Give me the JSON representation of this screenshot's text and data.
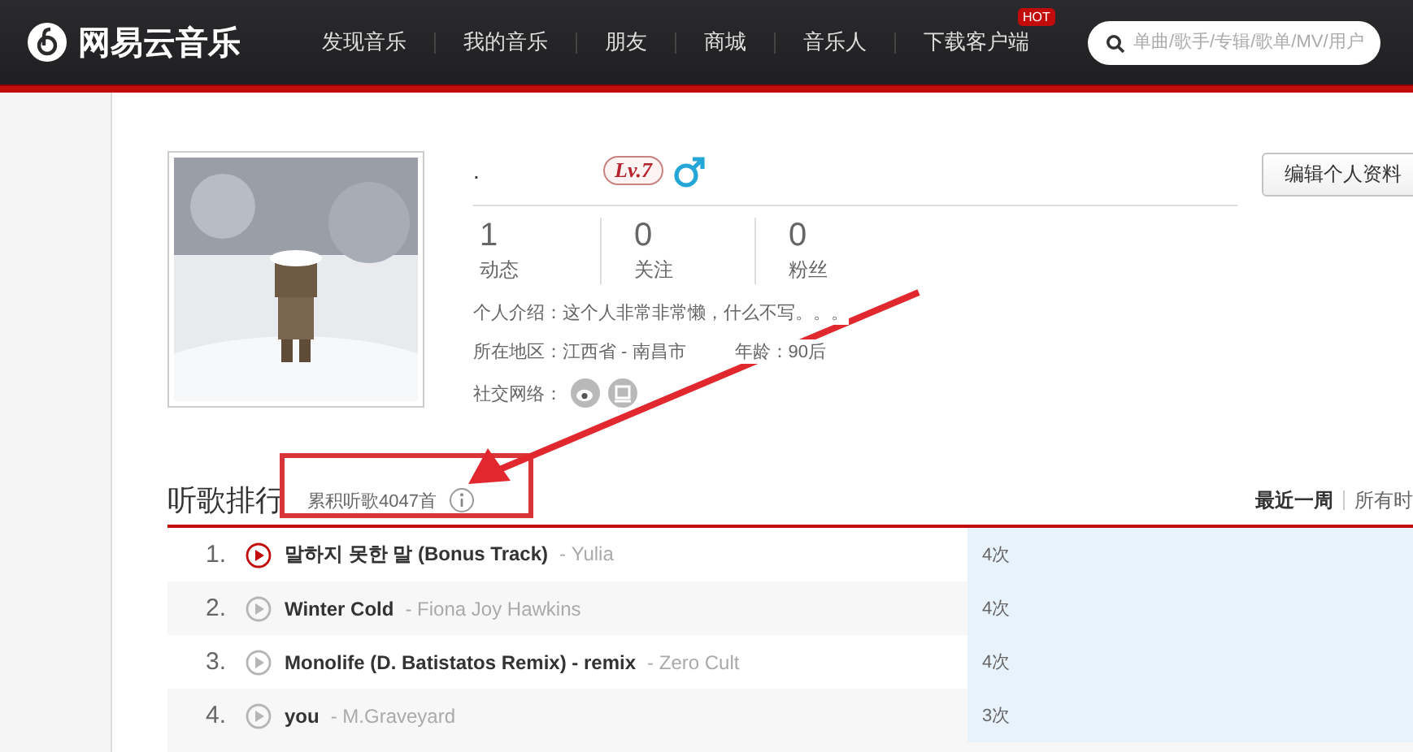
{
  "header": {
    "logo": "网易云音乐",
    "nav": [
      {
        "label": "发现音乐"
      },
      {
        "label": "我的音乐"
      },
      {
        "label": "朋友"
      },
      {
        "label": "商城"
      },
      {
        "label": "音乐人"
      },
      {
        "label": "下载客户端",
        "badge": "HOT"
      }
    ],
    "search": {
      "placeholder": "单曲/歌手/专辑/歌单/MV/用户"
    }
  },
  "profile": {
    "name": ".",
    "level": "Lv.7",
    "edit_button": "编辑个人资料",
    "stats": [
      {
        "value": "1",
        "label": "动态"
      },
      {
        "value": "0",
        "label": "关注"
      },
      {
        "value": "0",
        "label": "粉丝"
      }
    ],
    "intro": "个人介绍：这个人非常非常懒，什么不写。。。",
    "region": "所在地区：江西省 - 南昌市",
    "age": "年龄：90后",
    "social_label": "社交网络：",
    "social": [
      {
        "kind": "weibo"
      },
      {
        "kind": "douban"
      }
    ]
  },
  "ranking": {
    "title": "听歌排行",
    "total": "累积听歌4047首",
    "tabs": [
      {
        "label": "最近一周",
        "selected": true
      },
      {
        "label": "所有时",
        "selected": false
      }
    ],
    "rows": [
      {
        "rank": "1.",
        "title": "말하지 못한 말 (Bonus Track)",
        "artist": "- Yulia",
        "count": "4次",
        "level": 1,
        "playing": true
      },
      {
        "rank": "2.",
        "title": "Winter Cold",
        "artist": "- Fiona Joy Hawkins",
        "count": "4次",
        "level": 1,
        "playing": false
      },
      {
        "rank": "3.",
        "title": "Monolife (D. Batistatos Remix) - remix",
        "artist": "- Zero Cult",
        "count": "4次",
        "level": 1,
        "playing": false
      },
      {
        "rank": "4.",
        "title": "you",
        "artist": "- M.Graveyard",
        "count": "3次",
        "level": 1,
        "playing": false
      }
    ]
  }
}
